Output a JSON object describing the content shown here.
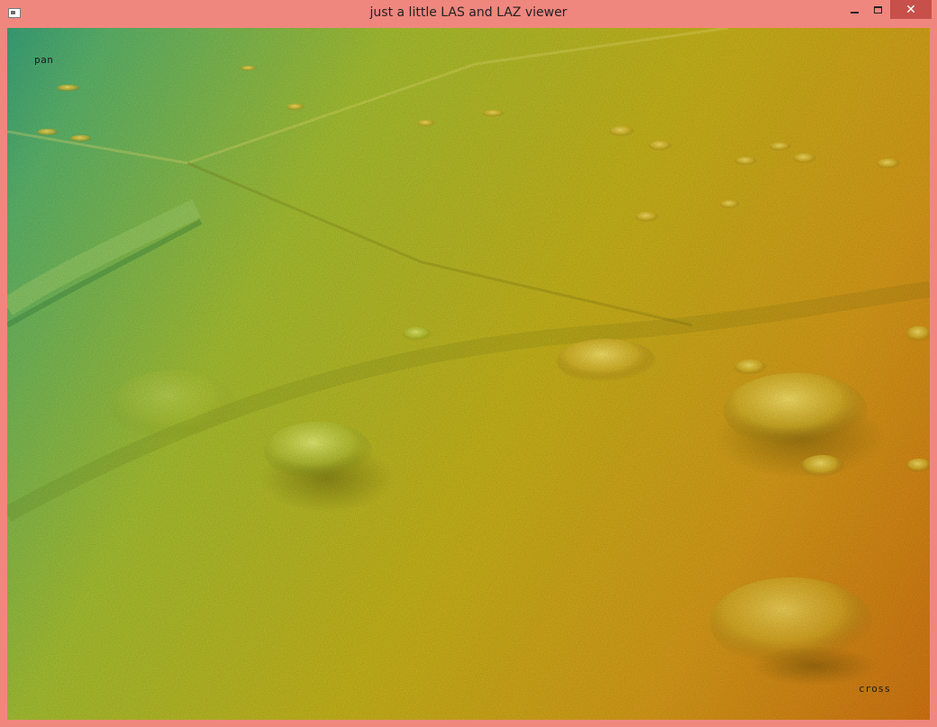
{
  "window": {
    "title": "just a little LAS and LAZ viewer",
    "border_color": "#f0877f",
    "close_button_color": "#c7504b",
    "icon": "app-window-icon",
    "buttons": {
      "minimize": "minimize-icon",
      "maximize": "maximize-icon",
      "close": "close-icon",
      "close_glyph": "✕"
    }
  },
  "viewer": {
    "mode_label": "pan",
    "cursor_label": "cross",
    "content": "shaded terrain surface",
    "colors": {
      "low": "#39a37a",
      "mid": "#c8b41a",
      "high": "#d27511"
    }
  }
}
